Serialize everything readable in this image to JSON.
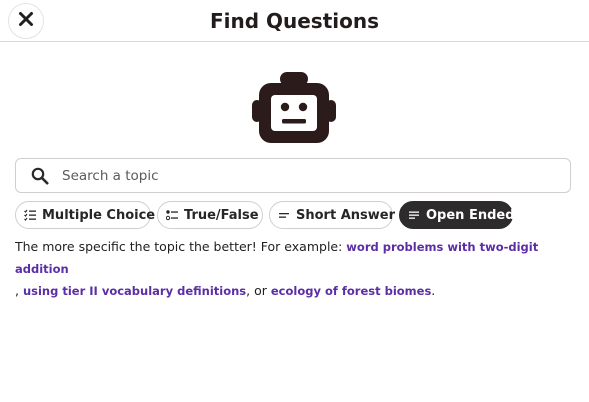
{
  "header": {
    "title": "Find Questions",
    "close_icon": "close-icon"
  },
  "illustration": {
    "icon": "robot-icon",
    "color": "#2b1b1b"
  },
  "search": {
    "placeholder": "Search a topic",
    "value": "",
    "icon": "search-icon"
  },
  "question_types": [
    {
      "label": "Multiple Choice",
      "icon": "checklist-icon",
      "selected": false
    },
    {
      "label": "True/False",
      "icon": "toggle-list-icon",
      "selected": false
    },
    {
      "label": "Short Answer",
      "icon": "short-lines-icon",
      "selected": false
    },
    {
      "label": "Open Ended",
      "icon": "paragraph-lines-icon",
      "selected": true
    }
  ],
  "hint": {
    "intro": "The more specific the topic the better! For example: ",
    "example_1": "word problems with two-digit addition",
    "sep_1": ", ",
    "example_2": "using tier II vocabulary definitions",
    "sep_2": ", or ",
    "example_3": "ecology of forest biomes",
    "end": "."
  },
  "colors": {
    "link": "#5b2ea6",
    "selected_chip": "#2e2b2d",
    "border": "#cfcfcf"
  }
}
